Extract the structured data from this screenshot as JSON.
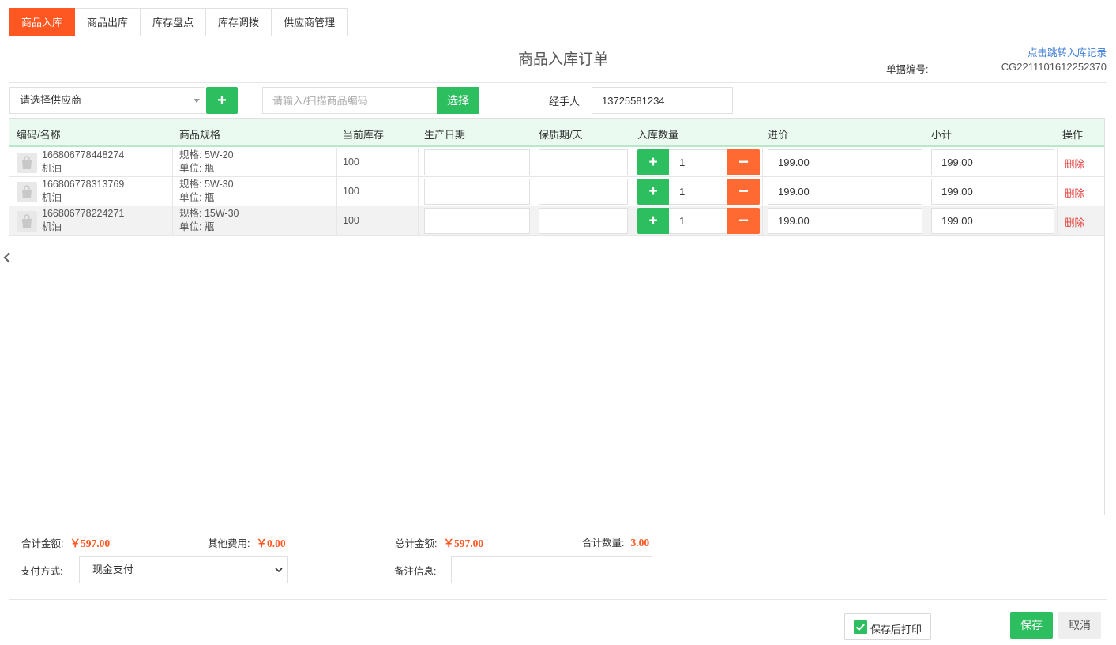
{
  "tabs": [
    {
      "label": "商品入库",
      "active": true
    },
    {
      "label": "商品出库",
      "active": false
    },
    {
      "label": "库存盘点",
      "active": false
    },
    {
      "label": "库存调拨",
      "active": false
    },
    {
      "label": "供应商管理",
      "active": false
    }
  ],
  "header": {
    "title": "商品入库订单",
    "record_link": "点击跳转入库记录",
    "order_no_label": "单据编号:",
    "order_no": "CG2211101612252370"
  },
  "toolbar": {
    "supplier_placeholder": "请选择供应商",
    "add_symbol": "+",
    "code_placeholder": "请输入/扫描商品编码",
    "choose_label": "选择",
    "handler_label": "经手人",
    "handler_value": "13725581234"
  },
  "table": {
    "columns": [
      "编码/名称",
      "商品规格",
      "当前库存",
      "生产日期",
      "保质期/天",
      "入库数量",
      "进价",
      "小计",
      "操作"
    ],
    "plus_symbol": "+",
    "minus_symbol": "−",
    "delete_label": "删除",
    "rows": [
      {
        "code": "166806778448274",
        "name": "机油",
        "spec": "规格: 5W-20",
        "unit": "单位: 瓶",
        "stock": "100",
        "production_date": "",
        "shelf_life": "",
        "qty": "1",
        "price": "199.00",
        "subtotal": "199.00"
      },
      {
        "code": "166806778313769",
        "name": "机油",
        "spec": "规格: 5W-30",
        "unit": "单位: 瓶",
        "stock": "100",
        "production_date": "",
        "shelf_life": "",
        "qty": "1",
        "price": "199.00",
        "subtotal": "199.00"
      },
      {
        "code": "166806778224271",
        "name": "机油",
        "spec": "规格: 15W-30",
        "unit": "单位: 瓶",
        "stock": "100",
        "production_date": "",
        "shelf_life": "",
        "qty": "1",
        "price": "199.00",
        "subtotal": "199.00"
      }
    ]
  },
  "summary": {
    "total_amount_label": "合计金额:",
    "total_amount": "￥597.00",
    "other_fee_label": "其他费用:",
    "other_fee": "￥0.00",
    "grand_total_label": "总计金额:",
    "grand_total": "￥597.00",
    "total_qty_label": "合计数量:",
    "total_qty": "3.00"
  },
  "payment": {
    "label": "支付方式:",
    "selected": "现金支付"
  },
  "remark": {
    "label": "备注信息:",
    "value": ""
  },
  "footer": {
    "print_after_save": "保存后打印",
    "print_checked": true,
    "save_label": "保存",
    "cancel_label": "取消"
  },
  "colors": {
    "accent_orange": "#ff5722",
    "accent_green": "#2dbe60",
    "danger_red": "#e53935",
    "link_blue": "#3a7bd5"
  }
}
